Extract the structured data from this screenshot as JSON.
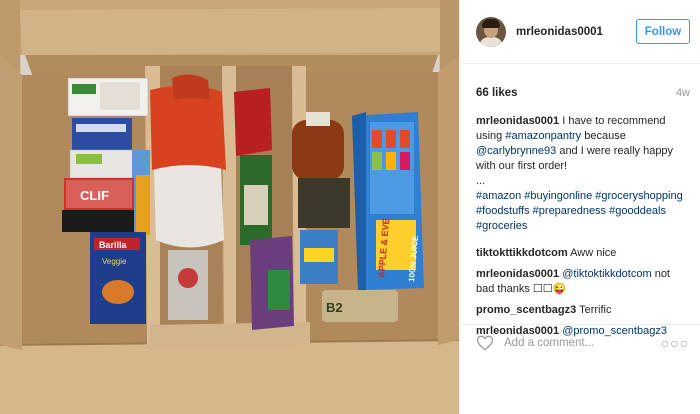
{
  "post": {
    "username": "mrleonidas0001",
    "follow_label": "Follow",
    "likes": "66 likes",
    "age": "4w",
    "caption": {
      "user": "mrleonidas0001",
      "text_1": " I have to recommend using ",
      "tag_1": "#amazonpantry",
      "text_2": " because ",
      "tag_2": "@carlybrynne93",
      "text_3": " and I were really happy with our first order!",
      "ellipsis": "...",
      "hashtags": "#amazon #buyingonline #groceryshopping #foodstuffs #preparedness #gooddeals #groceries"
    },
    "comments": [
      {
        "user": "tiktokttikkdotcom",
        "text_pre": " Aww nice",
        "mention": "",
        "text_post": ""
      },
      {
        "user": "mrleonidas0001",
        "text_pre": " ",
        "mention": "@tiktoktikkdotcom",
        "text_post": " not bad thanks ☐☐😜"
      },
      {
        "user": "promo_scentbagz3",
        "text_pre": " Terrific",
        "mention": "",
        "text_post": ""
      },
      {
        "user": "mrleonidas0001",
        "text_pre": " ",
        "mention": "@promo_scentbagz3",
        "text_post": ""
      }
    ],
    "add_comment_placeholder": "Add a comment...",
    "more_label": "○○○"
  },
  "photo": {
    "products": {
      "clif": "CLIF",
      "barilla": "Barilla",
      "veggie": "Veggie",
      "apple_eve": "APPLE & EVE",
      "juice": "100% JUICE",
      "b2": "B2"
    }
  },
  "colors": {
    "accent": "#3897f0",
    "tag": "#003569",
    "cardboard": "#c9a57a"
  }
}
